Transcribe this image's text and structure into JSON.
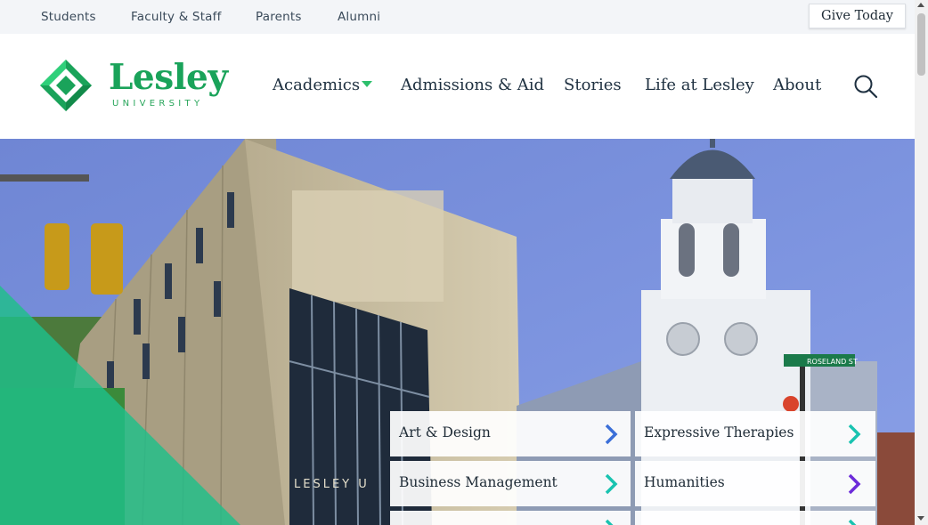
{
  "utility_nav": {
    "links": [
      "Students",
      "Faculty & Staff",
      "Parents",
      "Alumni"
    ],
    "give_button": "Give Today"
  },
  "logo": {
    "wordmark": "Lesley",
    "subtitle": "UNIVERSITY"
  },
  "main_nav": {
    "items": [
      "Academics",
      "Admissions & Aid",
      "Stories",
      "Life at Lesley",
      "About"
    ],
    "search_icon": "search-icon",
    "dropdown_icon": "caret-down-icon"
  },
  "hero": {
    "building_sign": "LESLEY U",
    "street_sign": "ROSELAND ST"
  },
  "program_tiles": [
    {
      "label": "Art & Design",
      "arrow": "chevron-right-icon"
    },
    {
      "label": "Expressive Therapies",
      "arrow": "chevron-right-icon"
    },
    {
      "label": "Business Management",
      "arrow": "chevron-right-icon"
    },
    {
      "label": "Humanities",
      "arrow": "chevron-right-icon"
    }
  ],
  "colors": {
    "brand_green": "#1aa35a",
    "accent_teal": "#19c3b0",
    "accent_purple": "#6c2bd9",
    "utility_bg": "#f3f5f8",
    "nav_text": "#1e3040"
  }
}
